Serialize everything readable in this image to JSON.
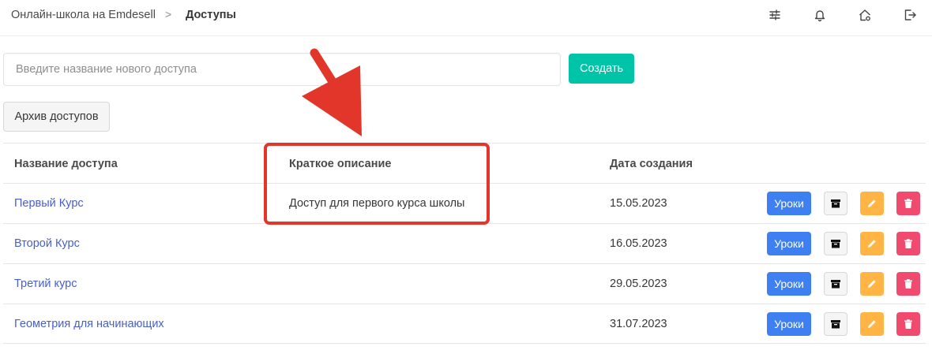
{
  "breadcrumb": {
    "root": "Онлайн-школа на Emdesell",
    "separator": ">",
    "current": "Доступы"
  },
  "top_icons": [
    "sliders-icon",
    "bell-icon",
    "home-settings-icon",
    "logout-icon"
  ],
  "create_form": {
    "placeholder": "Введите название нового доступа",
    "value": "",
    "button_label": "Создать"
  },
  "archive_button_label": "Архив доступов",
  "table": {
    "headers": [
      "Название доступа",
      "Краткое описание",
      "Дата создания"
    ],
    "rows": [
      {
        "name": "Первый Курс",
        "description": "Доступ для первого курса школы",
        "date": "15.05.2023",
        "lessons_label": "Уроки"
      },
      {
        "name": "Второй Курс",
        "description": "",
        "date": "16.05.2023",
        "lessons_label": "Уроки"
      },
      {
        "name": "Третий курс",
        "description": "",
        "date": "29.05.2023",
        "lessons_label": "Уроки"
      },
      {
        "name": "Геометрия для начинающих",
        "description": "",
        "date": "31.07.2023",
        "lessons_label": "Уроки"
      }
    ]
  },
  "colors": {
    "accent_create": "#00c4a7",
    "lessons": "#3e7ff1",
    "edit": "#ffb443",
    "delete": "#f04b6f",
    "link": "#485fc7",
    "annotation": "#e2362a"
  }
}
